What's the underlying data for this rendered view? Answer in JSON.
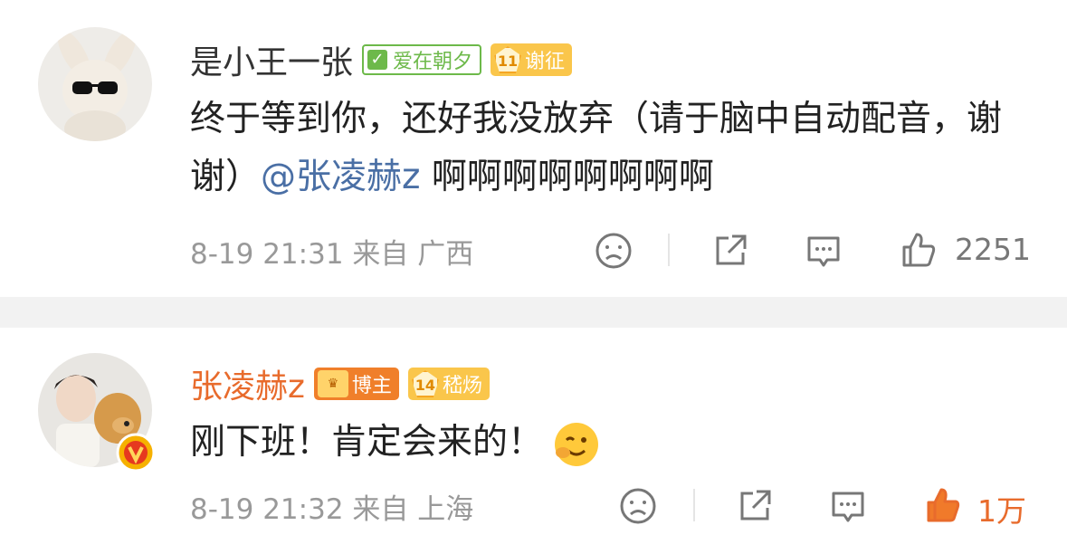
{
  "comments": [
    {
      "username": "是小王一张",
      "fan_badge": "爱在朝夕",
      "level": "11",
      "level_label": "谢征",
      "text_part1": "终于等到你，还好我没放弃（请于脑中自动配音，谢谢）",
      "mention": "@张凌赫z",
      "text_part2": " 啊啊啊啊啊啊啊啊",
      "time": "8-19 21:31",
      "location": "来自 广西",
      "likes": "2251"
    },
    {
      "username": "张凌赫z",
      "host_badge": "博主",
      "level": "14",
      "level_label": "嵇炀",
      "text": "刚下班！肯定会来的！",
      "time": "8-19 21:32",
      "location": "来自 上海",
      "likes": "1万"
    }
  ],
  "colors": {
    "accent": "#e86b2c",
    "mention": "#4a6fa5",
    "fan_green": "#6db94a",
    "level_yellow": "#fac64b"
  }
}
